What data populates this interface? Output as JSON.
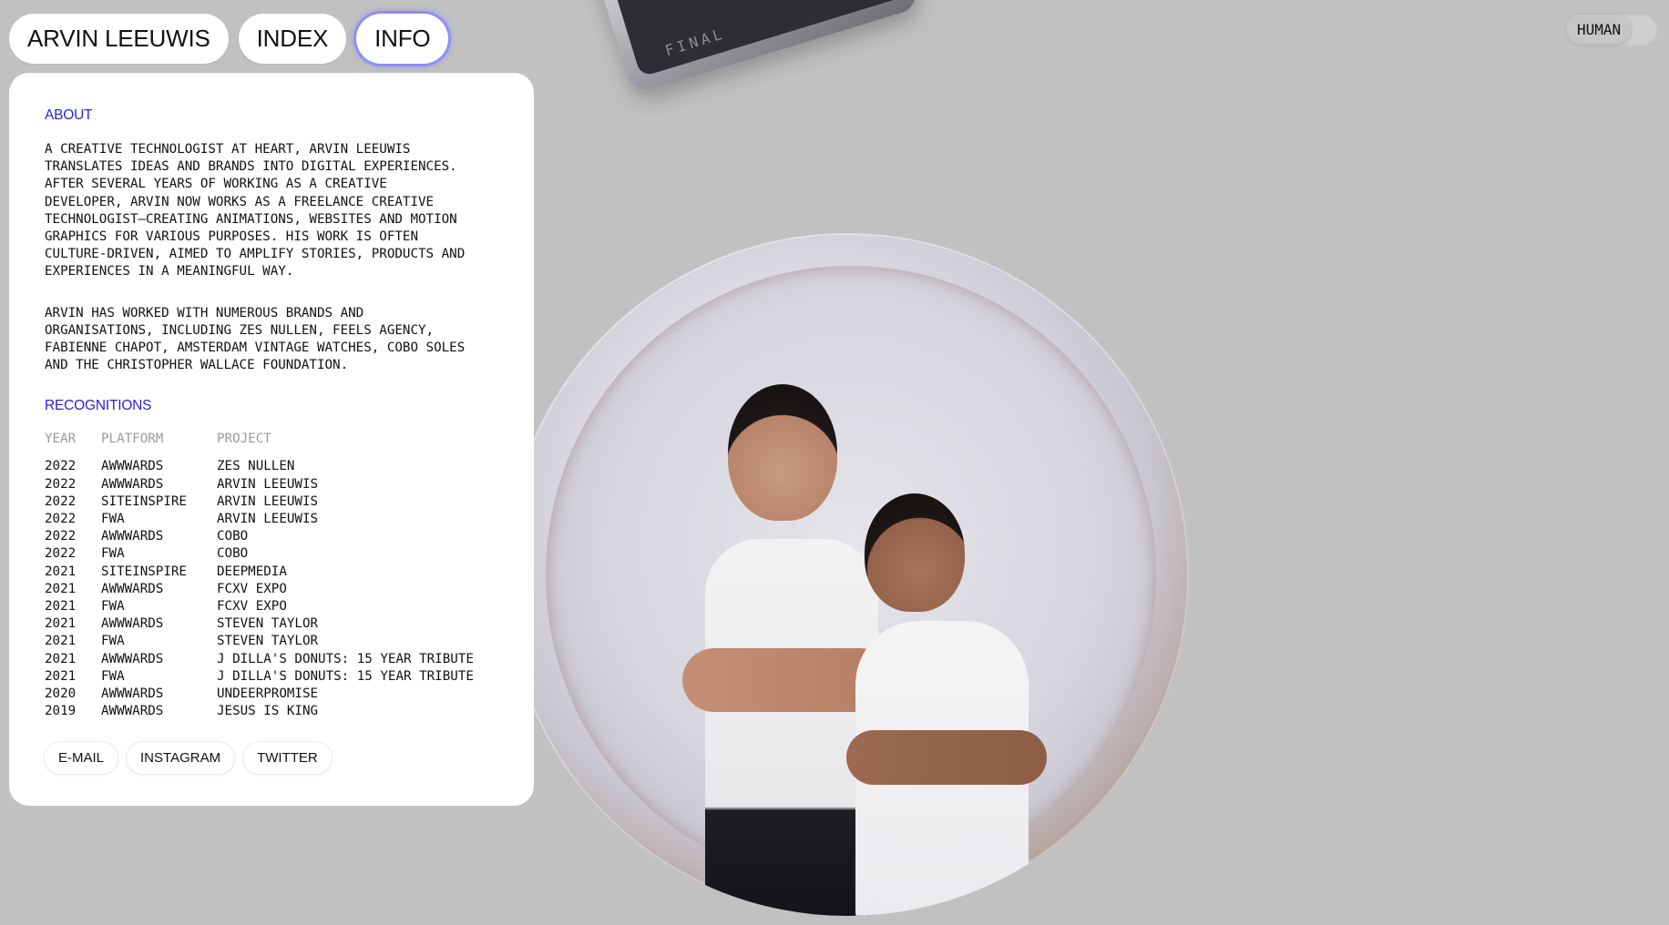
{
  "nav": {
    "items": [
      {
        "label": "ARVIN LEEUWIS"
      },
      {
        "label": "INDEX"
      },
      {
        "label": "INFO",
        "active": true
      }
    ]
  },
  "mode_toggle": {
    "label": "HUMAN"
  },
  "device": {
    "screen_text": "FINAL"
  },
  "about": {
    "title": "ABOUT",
    "paragraphs": [
      "A CREATIVE TECHNOLOGIST AT HEART, ARVIN LEEUWIS\nTRANSLATES IDEAS AND BRANDS INTO DIGITAL EXPERIENCES.\nAFTER SEVERAL YEARS OF WORKING AS A CREATIVE\nDEVELOPER, ARVIN NOW WORKS AS A FREELANCE CREATIVE\nTECHNOLOGIST—CREATING ANIMATIONS, WEBSITES AND MOTION\nGRAPHICS FOR VARIOUS PURPOSES. HIS WORK IS OFTEN\nCULTURE-DRIVEN, AIMED TO AMPLIFY STORIES, PRODUCTS AND\nEXPERIENCES IN A MEANINGFUL WAY.",
      "ARVIN HAS WORKED WITH NUMEROUS BRANDS AND\nORGANISATIONS, INCLUDING ZES NULLEN, FEELS AGENCY,\nFABIENNE CHAPOT, AMSTERDAM VINTAGE WATCHES, COBO SOLES\nAND THE CHRISTOPHER WALLACE FOUNDATION."
    ]
  },
  "recognitions": {
    "title": "RECOGNITIONS",
    "columns": [
      "YEAR",
      "PLATFORM",
      "PROJECT"
    ],
    "rows": [
      [
        "2022",
        "AWWWARDS",
        "ZES NULLEN"
      ],
      [
        "2022",
        "AWWWARDS",
        "ARVIN LEEUWIS"
      ],
      [
        "2022",
        "SITEINSPIRE",
        "ARVIN LEEUWIS"
      ],
      [
        "2022",
        "FWA",
        "ARVIN LEEUWIS"
      ],
      [
        "2022",
        "AWWWARDS",
        "COBO"
      ],
      [
        "2022",
        "FWA",
        "COBO"
      ],
      [
        "2021",
        "SITEINSPIRE",
        "DEEPMEDIA"
      ],
      [
        "2021",
        "AWWWARDS",
        "FCXV EXPO"
      ],
      [
        "2021",
        "FWA",
        "FCXV EXPO"
      ],
      [
        "2021",
        "AWWWARDS",
        "STEVEN TAYLOR"
      ],
      [
        "2021",
        "FWA",
        "STEVEN TAYLOR"
      ],
      [
        "2021",
        "AWWWARDS",
        "J DILLA'S DONUTS: 15 YEAR TRIBUTE"
      ],
      [
        "2021",
        "FWA",
        "J DILLA'S DONUTS: 15 YEAR TRIBUTE"
      ],
      [
        "2020",
        "AWWWARDS",
        "UNDEERPROMISE"
      ],
      [
        "2019",
        "AWWWARDS",
        "JESUS IS KING"
      ]
    ]
  },
  "links": [
    {
      "label": "E-MAIL"
    },
    {
      "label": "INSTAGRAM"
    },
    {
      "label": "TWITTER"
    }
  ],
  "colors": {
    "background": "#c1c1c1",
    "accent": "#2a24d8",
    "active_outline": "#8b8ff5"
  }
}
